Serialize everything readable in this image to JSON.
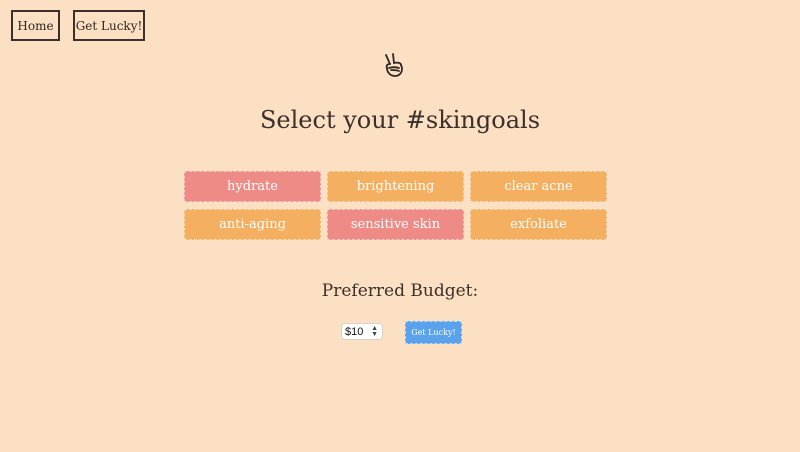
{
  "nav": {
    "home_label": "Home",
    "lucky_label": "Get Lucky!"
  },
  "logo": {
    "icon": "peace-hand-icon"
  },
  "title": "Select your #skingoals",
  "goals": [
    {
      "label": "hydrate",
      "selected": true
    },
    {
      "label": "brightening",
      "selected": false
    },
    {
      "label": "clear acne",
      "selected": false
    },
    {
      "label": "anti-aging",
      "selected": false
    },
    {
      "label": "sensitive skin",
      "selected": true
    },
    {
      "label": "exfoliate",
      "selected": false
    }
  ],
  "budget": {
    "label": "Preferred Budget:",
    "selected_value": "$10"
  },
  "submit_label": "Get Lucky!",
  "colors": {
    "background": "#fbe0c4",
    "goal_selected": "#ef8b86",
    "goal_unselected": "#f4af60",
    "submit": "#5aa3ec",
    "text": "#3d2f2a"
  }
}
